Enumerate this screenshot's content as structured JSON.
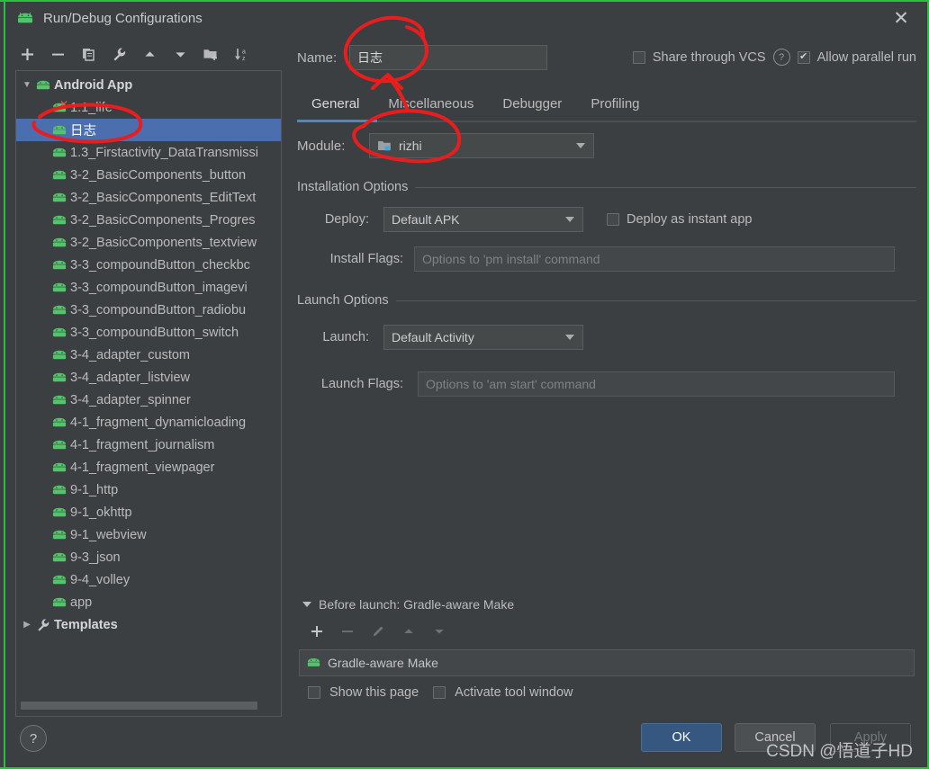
{
  "window": {
    "title": "Run/Debug Configurations",
    "title_icon": "android-icon",
    "close_label": "✕"
  },
  "left_toolbar": {
    "items": [
      {
        "name": "add-configuration-button",
        "glyph": "+"
      },
      {
        "name": "remove-configuration-button",
        "glyph": "−"
      },
      {
        "name": "copy-configuration-button",
        "glyph": "copy-icon"
      },
      {
        "name": "edit-templates-button",
        "glyph": "wrench-icon"
      },
      {
        "name": "move-up-button",
        "glyph": "▲"
      },
      {
        "name": "move-down-button",
        "glyph": "▼"
      },
      {
        "name": "move-into-folder-button",
        "glyph": "folder-add-icon"
      },
      {
        "name": "sort-configurations-button",
        "glyph": "sort-az-icon"
      }
    ]
  },
  "tree": {
    "nodes": [
      {
        "label": "Android App",
        "level": 0,
        "type": "group",
        "expanded": true,
        "icon": "android-icon"
      },
      {
        "label": "1.1_life",
        "level": 1,
        "type": "config",
        "icon": "android-icon",
        "error": true
      },
      {
        "label": "日志",
        "level": 1,
        "type": "config",
        "icon": "android-icon",
        "selected": true
      },
      {
        "label": "1.3_Firstactivity_DataTransmissi",
        "level": 1,
        "type": "config",
        "icon": "android-icon"
      },
      {
        "label": "3-2_BasicComponents_button",
        "level": 1,
        "type": "config",
        "icon": "android-icon"
      },
      {
        "label": "3-2_BasicComponents_EditText",
        "level": 1,
        "type": "config",
        "icon": "android-icon"
      },
      {
        "label": "3-2_BasicComponents_Progres",
        "level": 1,
        "type": "config",
        "icon": "android-icon"
      },
      {
        "label": "3-2_BasicComponents_textview",
        "level": 1,
        "type": "config",
        "icon": "android-icon"
      },
      {
        "label": "3-3_compoundButton_checkbc",
        "level": 1,
        "type": "config",
        "icon": "android-icon"
      },
      {
        "label": "3-3_compoundButton_imagevi",
        "level": 1,
        "type": "config",
        "icon": "android-icon"
      },
      {
        "label": "3-3_compoundButton_radiobu",
        "level": 1,
        "type": "config",
        "icon": "android-icon"
      },
      {
        "label": "3-3_compoundButton_switch",
        "level": 1,
        "type": "config",
        "icon": "android-icon"
      },
      {
        "label": "3-4_adapter_custom",
        "level": 1,
        "type": "config",
        "icon": "android-icon"
      },
      {
        "label": "3-4_adapter_listview",
        "level": 1,
        "type": "config",
        "icon": "android-icon"
      },
      {
        "label": "3-4_adapter_spinner",
        "level": 1,
        "type": "config",
        "icon": "android-icon"
      },
      {
        "label": "4-1_fragment_dynamicloading",
        "level": 1,
        "type": "config",
        "icon": "android-icon"
      },
      {
        "label": "4-1_fragment_journalism",
        "level": 1,
        "type": "config",
        "icon": "android-icon"
      },
      {
        "label": "4-1_fragment_viewpager",
        "level": 1,
        "type": "config",
        "icon": "android-icon"
      },
      {
        "label": "9-1_http",
        "level": 1,
        "type": "config",
        "icon": "android-icon"
      },
      {
        "label": "9-1_okhttp",
        "level": 1,
        "type": "config",
        "icon": "android-icon"
      },
      {
        "label": "9-1_webview",
        "level": 1,
        "type": "config",
        "icon": "android-icon"
      },
      {
        "label": "9-3_json",
        "level": 1,
        "type": "config",
        "icon": "android-icon"
      },
      {
        "label": "9-4_volley",
        "level": 1,
        "type": "config",
        "icon": "android-icon"
      },
      {
        "label": "app",
        "level": 1,
        "type": "config",
        "icon": "android-icon"
      },
      {
        "label": "Templates",
        "level": 0,
        "type": "group",
        "expanded": false,
        "icon": "wrench-icon"
      }
    ]
  },
  "form": {
    "name_label": "Name:",
    "name_value": "日志",
    "share_vcs_label": "Share through VCS",
    "share_vcs_checked": false,
    "help_glyph": "?",
    "allow_parallel_label": "Allow parallel run",
    "allow_parallel_checked": true,
    "tabs": [
      {
        "label": "General",
        "active": true
      },
      {
        "label": "Miscellaneous",
        "active": false
      },
      {
        "label": "Debugger",
        "active": false
      },
      {
        "label": "Profiling",
        "active": false
      }
    ],
    "module_label": "Module:",
    "module_value": "rizhi",
    "module_icon": "module-folder-icon",
    "installation_section": "Installation Options",
    "deploy_label": "Deploy:",
    "deploy_value": "Default APK",
    "instant_app_label": "Deploy as instant app",
    "instant_app_checked": false,
    "install_flags_label": "Install Flags:",
    "install_flags_value": "",
    "install_flags_placeholder": "Options to 'pm install' command",
    "launch_section": "Launch Options",
    "launch_label": "Launch:",
    "launch_value": "Default Activity",
    "launch_flags_label": "Launch Flags:",
    "launch_flags_value": "",
    "launch_flags_placeholder": "Options to 'am start' command"
  },
  "before_launch": {
    "header": "Before launch: Gradle-aware Make",
    "toolbar": [
      {
        "name": "before-launch-add-button",
        "glyph": "+",
        "enabled": true
      },
      {
        "name": "before-launch-remove-button",
        "glyph": "−",
        "enabled": false
      },
      {
        "name": "before-launch-edit-button",
        "glyph": "pencil-icon",
        "enabled": false
      },
      {
        "name": "before-launch-move-up-button",
        "glyph": "▲",
        "enabled": false
      },
      {
        "name": "before-launch-move-down-button",
        "glyph": "▼",
        "enabled": false
      }
    ],
    "items": [
      {
        "label": "Gradle-aware Make",
        "icon": "android-icon"
      }
    ],
    "show_page_label": "Show this page",
    "show_page_checked": false,
    "activate_tool_window_label": "Activate tool window",
    "activate_tool_window_checked": false
  },
  "bottom": {
    "help_glyph": "?",
    "ok_label": "OK",
    "cancel_label": "Cancel",
    "apply_label": "Apply",
    "apply_enabled": false
  },
  "watermark": {
    "text": "CSDN @悟道子HD"
  },
  "colors": {
    "window_bg": "#3c3f41",
    "accent_blue": "#4a88c7",
    "selection_blue": "#4b6eaf",
    "ok_button": "#365880",
    "android_green": "#52c46a",
    "annotation_red": "#e81e1e",
    "window_border_green": "#2cbf3f"
  }
}
